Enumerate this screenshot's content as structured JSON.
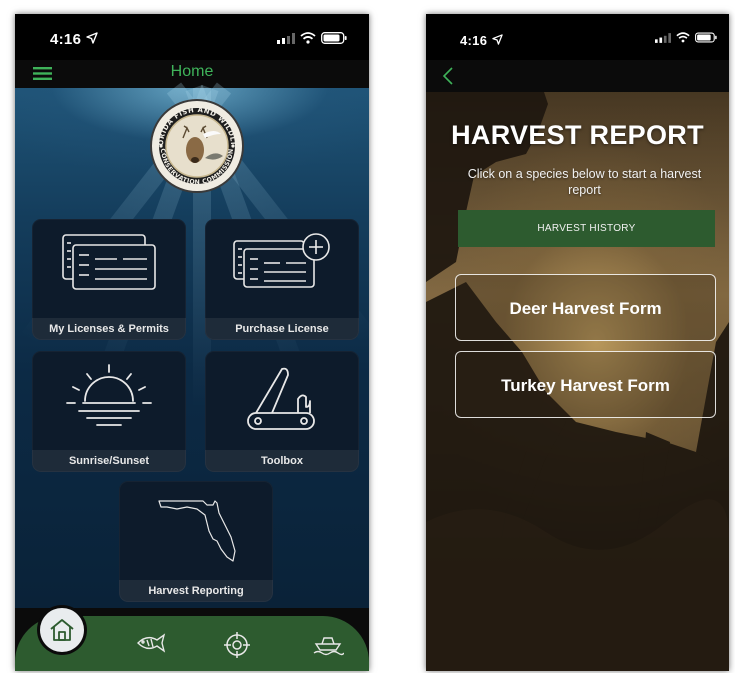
{
  "left_phone": {
    "status": {
      "time": "4:16"
    },
    "header": {
      "title": "Home"
    },
    "tiles": [
      {
        "label": "My Licenses & Permits",
        "icon": "license-cards-icon"
      },
      {
        "label": "Purchase License",
        "icon": "add-license-icon"
      },
      {
        "label": "Sunrise/Sunset",
        "icon": "sunrise-icon"
      },
      {
        "label": "Toolbox",
        "icon": "pocket-knife-icon"
      },
      {
        "label": "Harvest Reporting",
        "icon": "florida-map-icon"
      }
    ],
    "logo": {
      "top_text": "FLORIDA FISH AND WILDLIFE",
      "bottom_text": "CONSERVATION COMMISSION"
    },
    "bottom_nav": [
      "home-icon",
      "fish-icon",
      "target-icon",
      "boat-icon"
    ],
    "colors": {
      "accent_green": "#3fb35a",
      "nav_green": "#2d5b2f",
      "tile_bg": "#0d1b2b"
    }
  },
  "right_phone": {
    "status": {
      "time": "4:16"
    },
    "title": "HARVEST REPORT",
    "subtitle": "Click on a species below to start a harvest report",
    "history_button": "HARVEST HISTORY",
    "forms": [
      "Deer Harvest Form",
      "Turkey Harvest Form"
    ],
    "colors": {
      "button_green": "#2d5b2f"
    }
  }
}
